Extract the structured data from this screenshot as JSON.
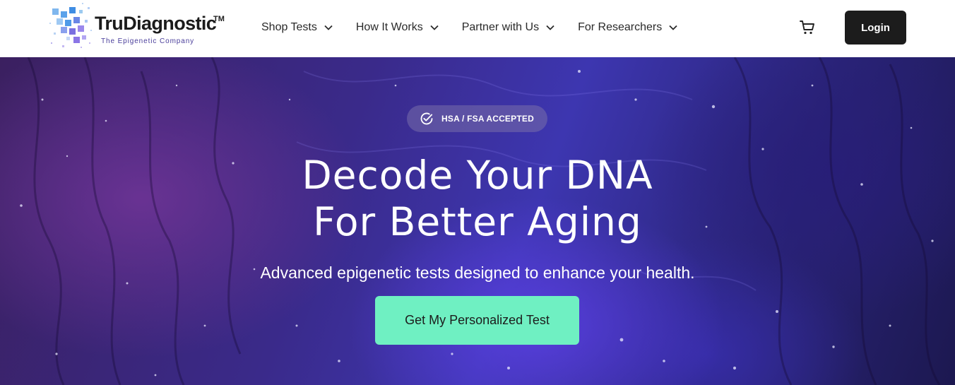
{
  "brand": {
    "name": "TruDiagnostic",
    "trademark": "TM",
    "tagline": "The Epigenetic Company"
  },
  "nav": {
    "items": [
      {
        "label": "Shop Tests",
        "icon": "chevron-down-icon"
      },
      {
        "label": "How It Works",
        "icon": "chevron-down-icon"
      },
      {
        "label": "Partner with Us",
        "icon": "chevron-down-icon"
      },
      {
        "label": "For Researchers",
        "icon": "chevron-down-icon"
      }
    ]
  },
  "header_actions": {
    "cart_icon": "cart-icon",
    "login_label": "Login"
  },
  "hero": {
    "badge_icon": "check-circle-icon",
    "badge_label": "HSA / FSA ACCEPTED",
    "headline_line1": "Decode Your DNA",
    "headline_line2": "For Better Aging",
    "subheadline": "Advanced epigenetic tests designed to enhance your health.",
    "cta_label": "Get My Personalized Test"
  },
  "colors": {
    "cta": "#6ff0c2",
    "login_bg": "#1c1c1c",
    "tagline": "#4a3e9b",
    "hero_base": "#3a2a8a"
  }
}
